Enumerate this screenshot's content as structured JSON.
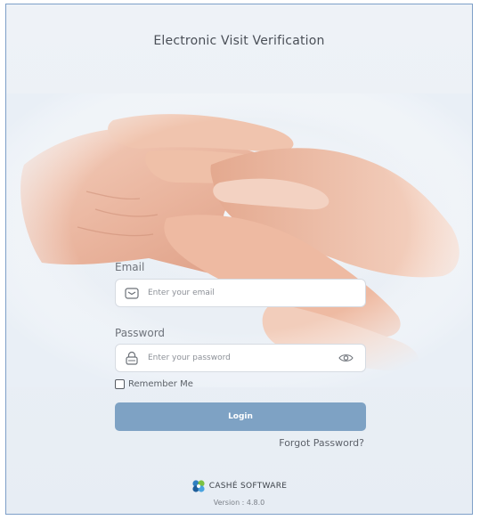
{
  "header": {
    "title": "Electronic Visit Verification"
  },
  "form": {
    "email_label": "Email",
    "email_placeholder": "Enter your email",
    "password_label": "Password",
    "password_placeholder": "Enter your password",
    "remember_label": "Remember Me",
    "remember_checked": false,
    "login_label": "Login",
    "forgot_label": "Forgot Password?"
  },
  "footer": {
    "brand": "CASHÉ SOFTWARE",
    "version": "Version : 4.8.0"
  },
  "colors": {
    "accent": "#7ea2c4",
    "background": "#e9eff6",
    "border": "#7d9fc8"
  },
  "icons": {
    "email": "envelope-icon",
    "password": "lock-icon",
    "toggle": "eye-icon",
    "logo": "cashe-logo-icon"
  }
}
